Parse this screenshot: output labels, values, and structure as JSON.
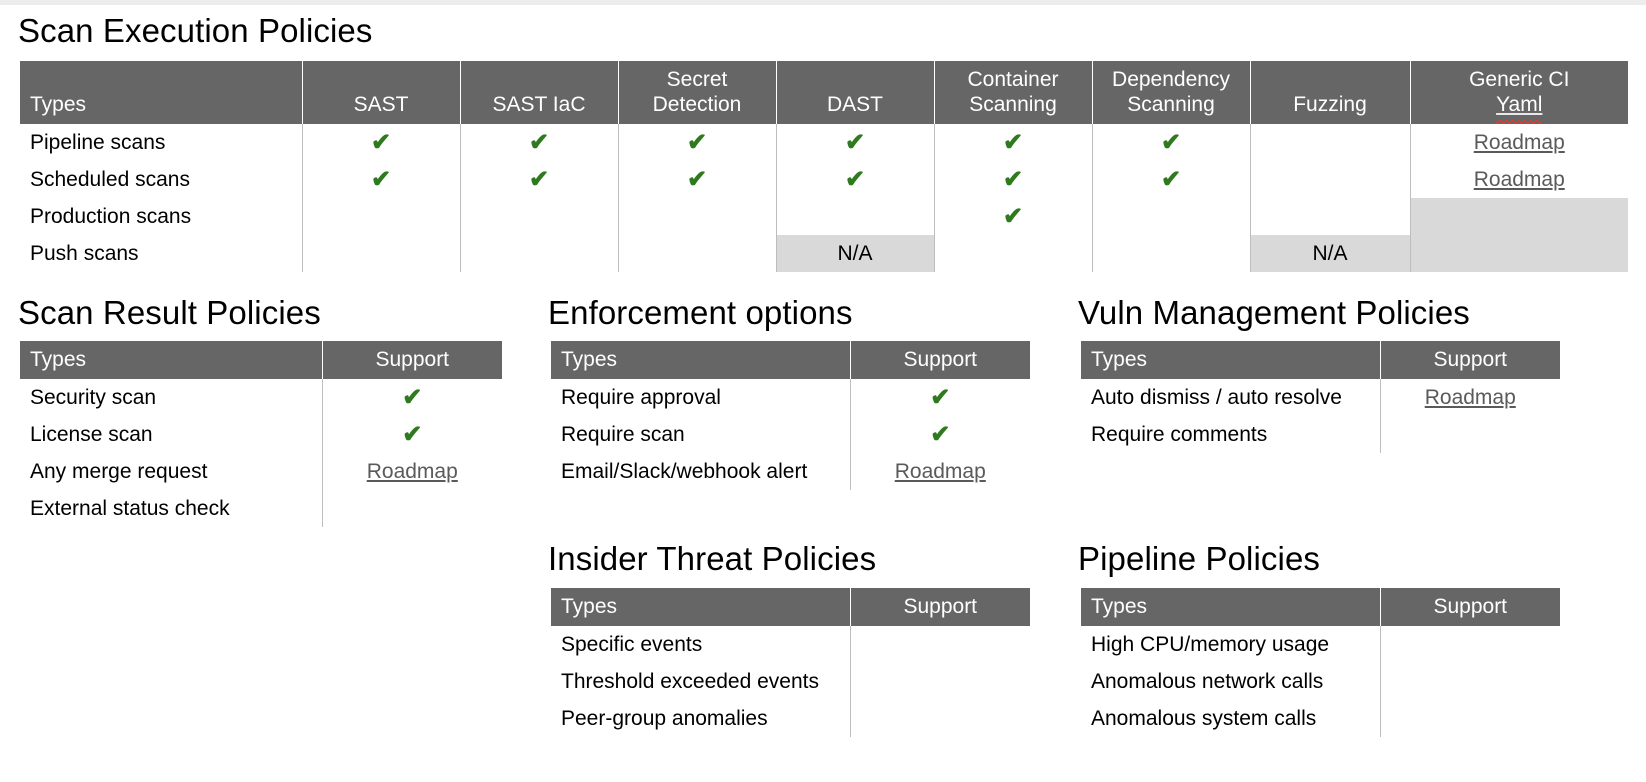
{
  "icons": {
    "check": "✔"
  },
  "colors": {
    "header_gray": "#666666",
    "check_green": "#2f7a1e",
    "na_gray": "#d9d9d9",
    "link_gray": "#5a5a5a"
  },
  "labels": {
    "na": "N/A",
    "roadmap": "Roadmap"
  },
  "scan_execution": {
    "title": "Scan Execution Policies",
    "columns": [
      "Types",
      "SAST",
      "SAST IaC",
      "Secret Detection",
      "DAST",
      "Container Scanning",
      "Dependency Scanning",
      "Fuzzing",
      "Generic CI Yaml"
    ],
    "columns_wrapped": [
      [
        "Types"
      ],
      [
        "SAST"
      ],
      [
        "SAST IaC"
      ],
      [
        "Secret",
        "Detection"
      ],
      [
        "DAST"
      ],
      [
        "Container",
        "Scanning"
      ],
      [
        "Dependency",
        "Scanning"
      ],
      [
        "Fuzzing"
      ],
      [
        "Generic CI",
        "Yaml"
      ]
    ],
    "rows": [
      {
        "type": "Pipeline scans",
        "cells": [
          "check",
          "check",
          "check",
          "check",
          "check",
          "check",
          "",
          "roadmap"
        ]
      },
      {
        "type": "Scheduled scans",
        "cells": [
          "check",
          "check",
          "check",
          "check",
          "check",
          "check",
          "",
          "roadmap"
        ]
      },
      {
        "type": "Production scans",
        "cells": [
          "",
          "",
          "",
          "",
          "check",
          "",
          "",
          "shade"
        ]
      },
      {
        "type": "Push scans",
        "cells": [
          "",
          "",
          "",
          "na",
          "",
          "",
          "na",
          "shade"
        ]
      }
    ]
  },
  "scan_result": {
    "title": "Scan Result Policies",
    "columns": [
      "Types",
      "Support"
    ],
    "rows": [
      {
        "type": "Security scan",
        "support": "check"
      },
      {
        "type": "License scan",
        "support": "check"
      },
      {
        "type": "Any merge request",
        "support": "roadmap"
      },
      {
        "type": "External status check",
        "support": ""
      }
    ]
  },
  "enforcement": {
    "title": "Enforcement options",
    "columns": [
      "Types",
      "Support"
    ],
    "rows": [
      {
        "type": "Require approval",
        "support": "check"
      },
      {
        "type": "Require scan",
        "support": "check"
      },
      {
        "type": "Email/Slack/webhook alert",
        "support": "roadmap"
      }
    ]
  },
  "vuln_management": {
    "title": "Vuln Management Policies",
    "columns": [
      "Types",
      "Support"
    ],
    "rows": [
      {
        "type": "Auto dismiss / auto resolve",
        "support": "roadmap"
      },
      {
        "type": "Require comments",
        "support": ""
      }
    ]
  },
  "insider_threat": {
    "title": "Insider Threat Policies",
    "columns": [
      "Types",
      "Support"
    ],
    "rows": [
      {
        "type": "Specific events",
        "support": ""
      },
      {
        "type": "Threshold exceeded events",
        "support": ""
      },
      {
        "type": "Peer-group anomalies",
        "support": ""
      }
    ]
  },
  "pipeline_policies": {
    "title": "Pipeline Policies",
    "columns": [
      "Types",
      "Support"
    ],
    "rows": [
      {
        "type": "High CPU/memory usage",
        "support": ""
      },
      {
        "type": "Anomalous network calls",
        "support": ""
      },
      {
        "type": "Anomalous system calls",
        "support": ""
      }
    ]
  }
}
